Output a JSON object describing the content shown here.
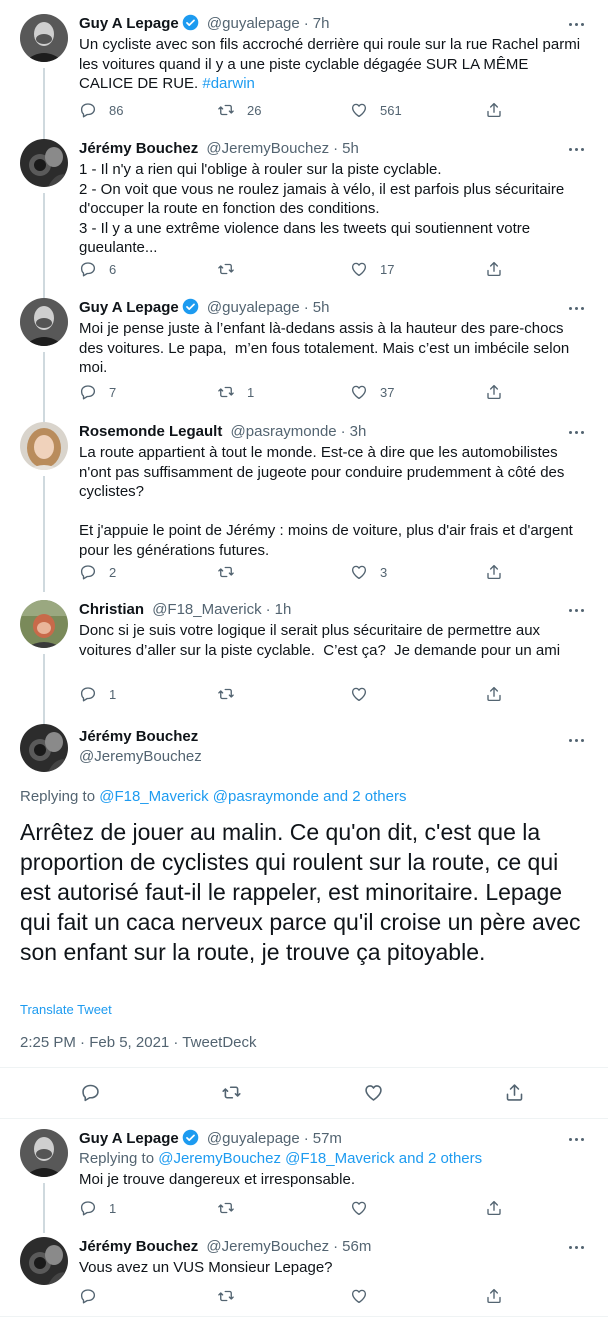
{
  "tweets": [
    {
      "name": "Guy A Lepage",
      "handle": "@guyalepage",
      "time": "7h",
      "verified": true,
      "text_parts": [
        "Un cycliste avec son fils accroché derrière qui roule sur la rue Rachel parmi les voitures quand il y a une piste cyclable dégagée SUR LA MÊME CALICE DE RUE. ",
        "#darwin"
      ],
      "replies": "86",
      "retweets": "26",
      "likes": "561"
    },
    {
      "name": "Jérémy Bouchez",
      "handle": "@JeremyBouchez",
      "time": "5h",
      "text": "1 - Il n'y a rien qui l'oblige à rouler sur la piste cyclable.\n2 - On voit que vous ne roulez jamais à vélo, il est parfois plus sécuritaire d'occuper la route en fonction des conditions.\n3 - Il y a une extrême violence dans les tweets qui soutiennent votre gueulante...",
      "replies": "6",
      "retweets": "",
      "likes": "17"
    },
    {
      "name": "Guy A Lepage",
      "handle": "@guyalepage",
      "time": "5h",
      "verified": true,
      "text": "Moi je pense juste à l’enfant là-dedans assis à la hauteur des pare-chocs des voitures. Le papa,  m’en fous totalement. Mais c’est un imbécile selon moi.",
      "replies": "7",
      "retweets": "1",
      "likes": "37"
    },
    {
      "name": "Rosemonde Legault",
      "handle": "@pasraymonde",
      "time": "3h",
      "text": "La route appartient à tout le monde. Est-ce à dire que les automobilistes n'ont pas suffisamment de jugeote pour conduire prudemment à côté des cyclistes?\n\nEt j'appuie le point de Jérémy : moins de voiture, plus d'air frais et d'argent pour les générations futures.",
      "replies": "2",
      "retweets": "",
      "likes": "3"
    },
    {
      "name": "Christian",
      "handle": "@F18_Maverick",
      "time": "1h",
      "text": "Donc si je suis votre logique il serait plus sécuritaire de permettre aux voitures d’aller sur la piste cyclable.  C’est ça?  Je demande pour un ami",
      "replies": "1",
      "retweets": "",
      "likes": ""
    }
  ],
  "main_tweet": {
    "name": "Jérémy Bouchez",
    "handle": "@JeremyBouchez",
    "replying_label": "Replying to ",
    "replying_links": "@F18_Maverick @pasraymonde and 2 others",
    "text": "Arrêtez de jouer au malin. Ce qu'on dit, c'est que la proportion de cyclistes qui roulent sur la route, ce qui est autorisé faut-il le rappeler, est minoritaire. Lepage qui fait un caca nerveux parce qu'il croise un père avec son enfant sur la route, je trouve ça pitoyable.",
    "translate": "Translate Tweet",
    "timestamp": "2:25 PM · Feb 5, 2021 · TweetDeck"
  },
  "replies_below": [
    {
      "name": "Guy A Lepage",
      "handle": "@guyalepage",
      "time": "57m",
      "verified": true,
      "replying_label": "Replying to ",
      "replying_links": "@JeremyBouchez @F18_Maverick and 2 others",
      "text": "Moi je trouve dangereux et irresponsable.",
      "replies": "1",
      "retweets": "",
      "likes": ""
    },
    {
      "name": "Jérémy Bouchez",
      "handle": "@JeremyBouchez",
      "time": "56m",
      "text": "Vous avez un VUS Monsieur Lepage?",
      "replies": "",
      "retweets": "",
      "likes": ""
    }
  ],
  "separator": "·",
  "colors": {
    "text": "#0f1419",
    "secondary": "#536471",
    "link": "#1d9bf0",
    "verified": "#1d9bf0",
    "thread_line": "#cfd9de"
  },
  "icons": [
    "reply-icon",
    "retweet-icon",
    "like-icon",
    "share-icon",
    "more-icon",
    "verified-badge-icon"
  ]
}
